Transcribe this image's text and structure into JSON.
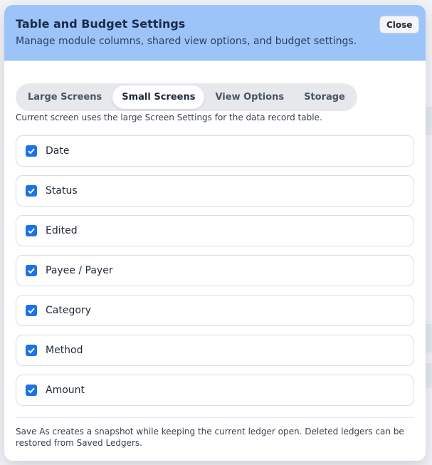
{
  "modal": {
    "title": "Table and Budget Settings",
    "subtitle": "Manage module columns, shared view options, and budget settings.",
    "close_label": "Close"
  },
  "tabs": [
    {
      "label": "Large Screens",
      "active": false
    },
    {
      "label": "Small Screens",
      "active": true
    },
    {
      "label": "View Options",
      "active": false
    },
    {
      "label": "Storage",
      "active": false
    }
  ],
  "info_text": "Current screen uses the large Screen Settings for the data record table.",
  "columns": [
    {
      "label": "Date",
      "checked": true
    },
    {
      "label": "Status",
      "checked": true
    },
    {
      "label": "Edited",
      "checked": true
    },
    {
      "label": "Payee / Payer",
      "checked": true
    },
    {
      "label": "Category",
      "checked": true
    },
    {
      "label": "Method",
      "checked": true
    },
    {
      "label": "Amount",
      "checked": true
    }
  ],
  "footer_note": "Save As creates a snapshot while keeping the current ledger open. Deleted ledgers can be restored from Saved Ledgers.",
  "colors": {
    "header_bg": "#9dc4f8",
    "checkbox_accent": "#1a73e8"
  }
}
